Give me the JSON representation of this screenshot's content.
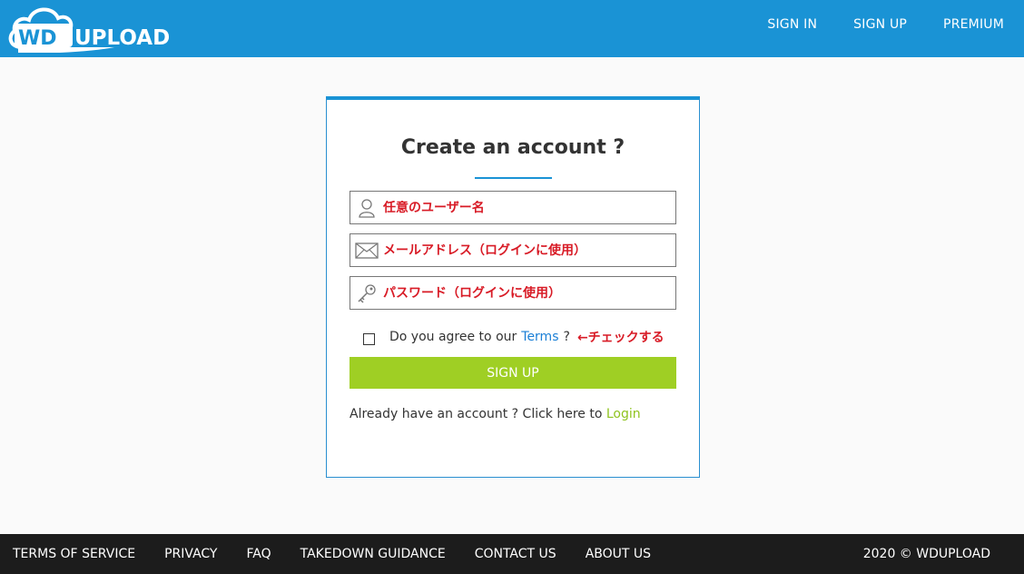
{
  "header": {
    "logo": {
      "part1": "WD",
      "part2": "UPLOAD"
    },
    "nav": [
      {
        "label": "SIGN IN"
      },
      {
        "label": "SIGN UP"
      },
      {
        "label": "PREMIUM"
      }
    ]
  },
  "form": {
    "title": "Create an account ?",
    "username": {
      "placeholder": "任意のユーザー名",
      "icon": "user-icon"
    },
    "email": {
      "placeholder": "メールアドレス（ログインに使用）",
      "icon": "envelope-icon"
    },
    "password": {
      "placeholder": "パスワード（ログインに使用）",
      "icon": "key-icon"
    },
    "agree": {
      "prefix": "Do you agree to our",
      "terms_link": "Terms",
      "suffix": "?",
      "annotation": "←チェックする",
      "checked": false
    },
    "submit_label": "SIGN UP",
    "login_prompt": "Already have an account ? Click here to",
    "login_link": "Login"
  },
  "footer": {
    "links": [
      {
        "label": "TERMS OF SERVICE"
      },
      {
        "label": "PRIVACY"
      },
      {
        "label": "FAQ"
      },
      {
        "label": "TAKEDOWN GUIDANCE"
      },
      {
        "label": "CONTACT US"
      },
      {
        "label": "ABOUT US"
      }
    ],
    "copyright": "2020 © WDUPLOAD"
  },
  "colors": {
    "header_bg": "#1a93d5",
    "accent": "#1a93d5",
    "signup_button": "#9fcf24",
    "annotation_red": "#d81b26",
    "login_link": "#8fc31f",
    "footer_bg": "#1c1c1c"
  }
}
